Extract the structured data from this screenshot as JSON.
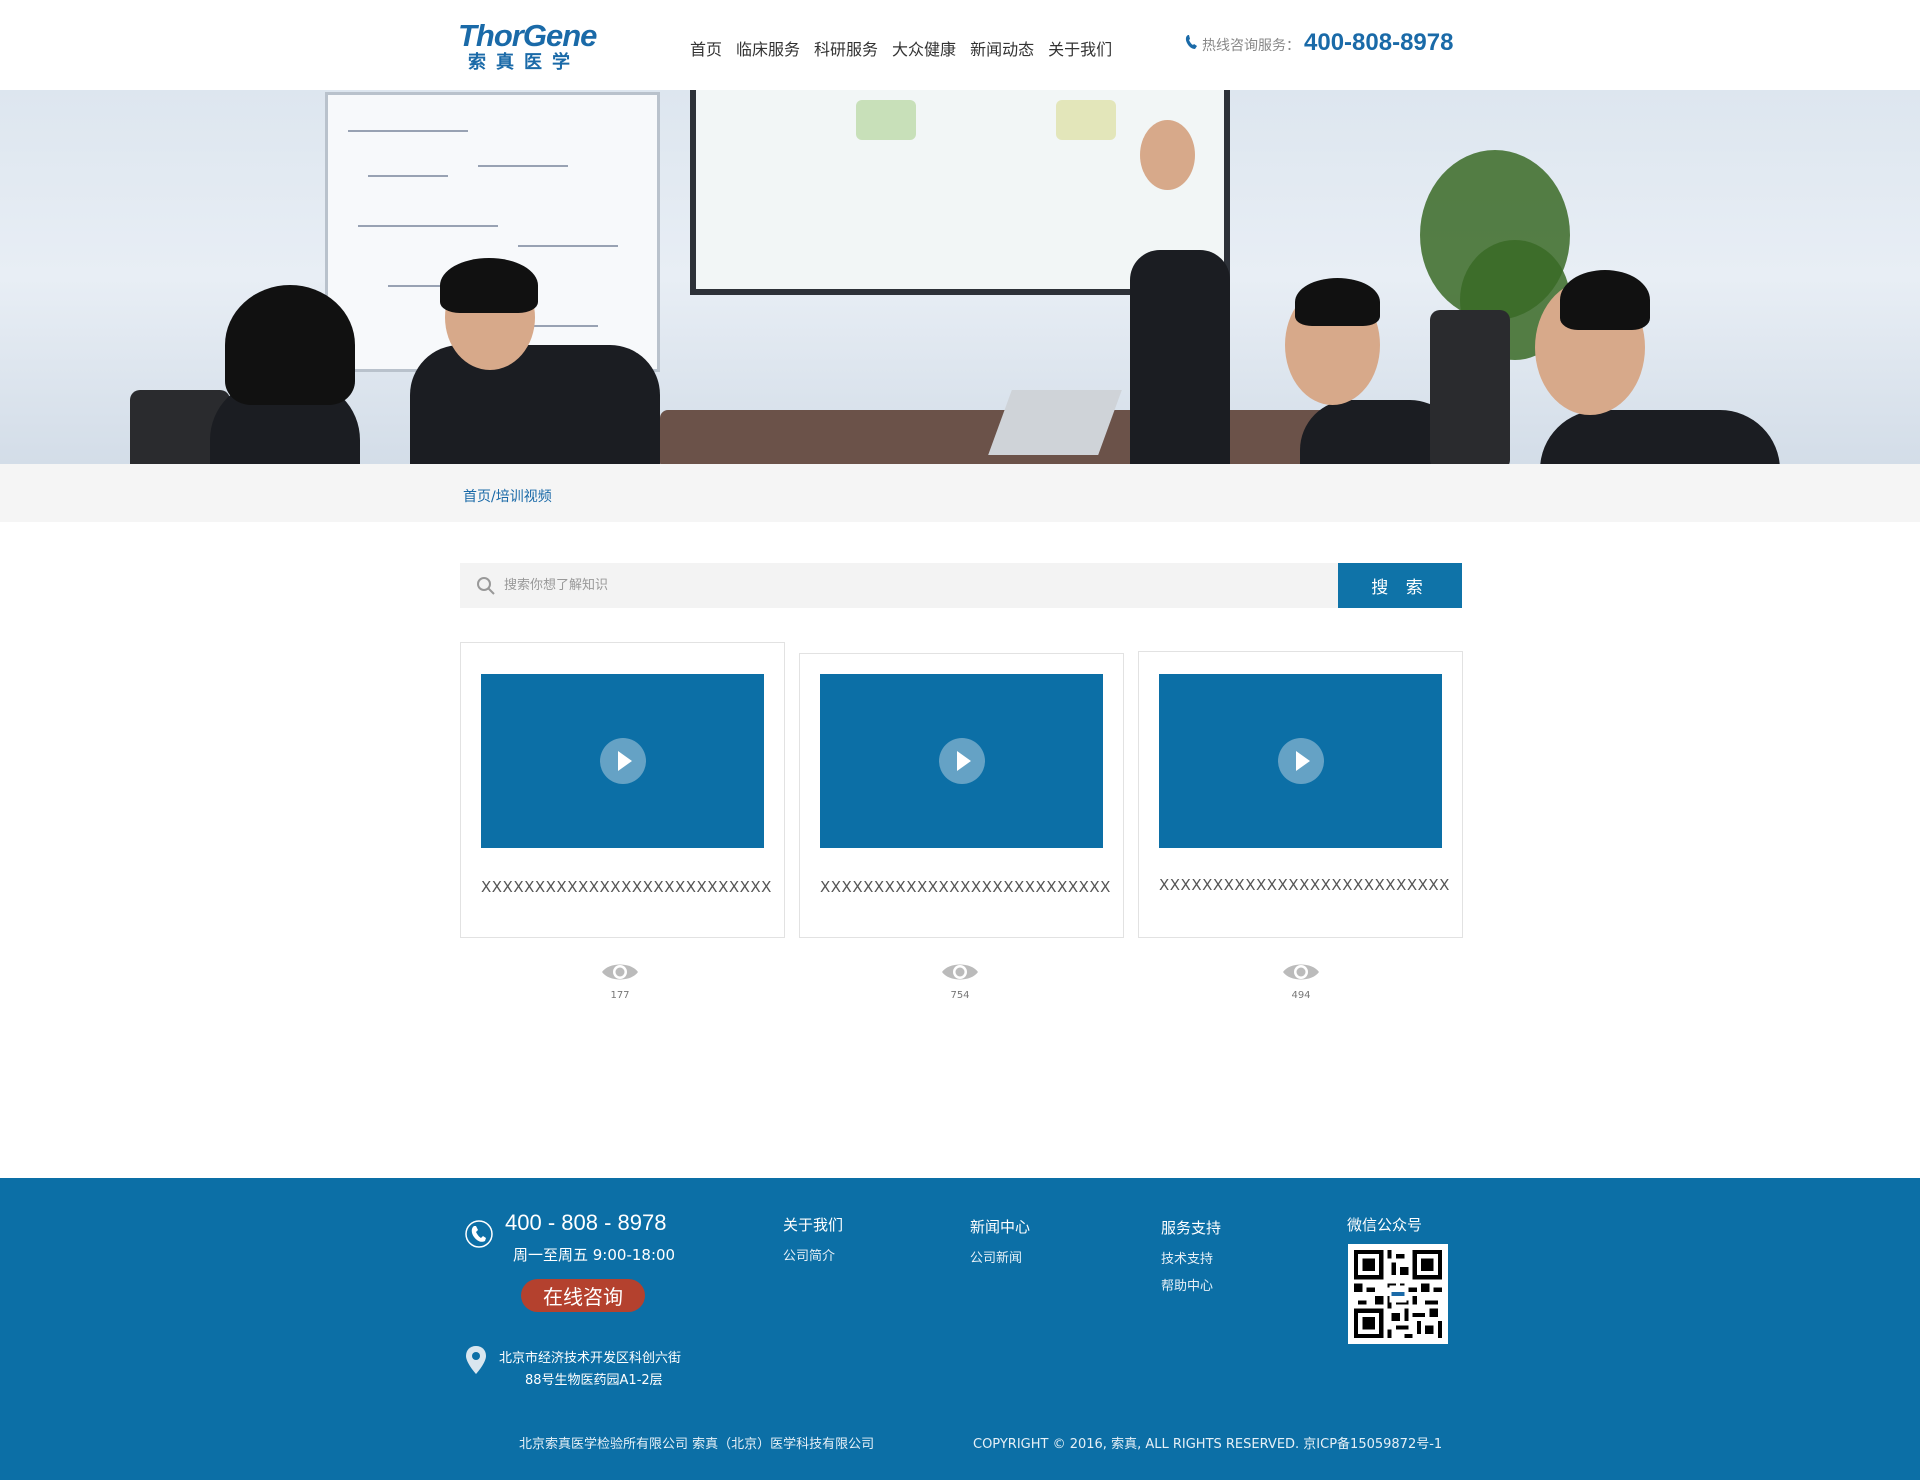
{
  "header": {
    "logo_en": "ThorGene",
    "logo_cn": "索真医学",
    "nav": [
      "首页",
      "临床服务",
      "科研服务",
      "大众健康",
      "新闻动态",
      "关于我们"
    ],
    "hotline_label": "热线咨询服务：",
    "hotline_number": "400-808-8978"
  },
  "breadcrumb": "首页/培训视频",
  "search": {
    "placeholder": "搜索你想了解知识",
    "button": "搜 索"
  },
  "videos": [
    {
      "title": "XXXXXXXXXXXXXXXXXXXXXXXXXXX",
      "views": "177"
    },
    {
      "title": "XXXXXXXXXXXXXXXXXXXXXXXXXXX",
      "views": "754"
    },
    {
      "title": "XXXXXXXXXXXXXXXXXXXXXXXXXXX",
      "views": "494"
    }
  ],
  "footer": {
    "phone": "400 - 808 - 8978",
    "hours": "周一至周五 9:00-18:00",
    "consult": "在线咨询",
    "address_line1": "北京市经济技术开发区科创六街",
    "address_line2": "88号生物医药园A1-2层",
    "cols": [
      {
        "title": "关于我们",
        "links": [
          "公司简介"
        ]
      },
      {
        "title": "新闻中心",
        "links": [
          "公司新闻"
        ]
      },
      {
        "title": "服务支持",
        "links": [
          "技术支持",
          "帮助中心"
        ]
      }
    ],
    "wechat_title": "微信公众号",
    "companies": "北京索真医学检验所有限公司    索真（北京）医学科技有限公司",
    "copyright": "COPYRIGHT © 2016, 索真, ALL RIGHTS RESERVED. 京ICP备15059872号-1"
  },
  "colors": {
    "brand": "#0c6fa6",
    "consult": "#b4412e"
  }
}
